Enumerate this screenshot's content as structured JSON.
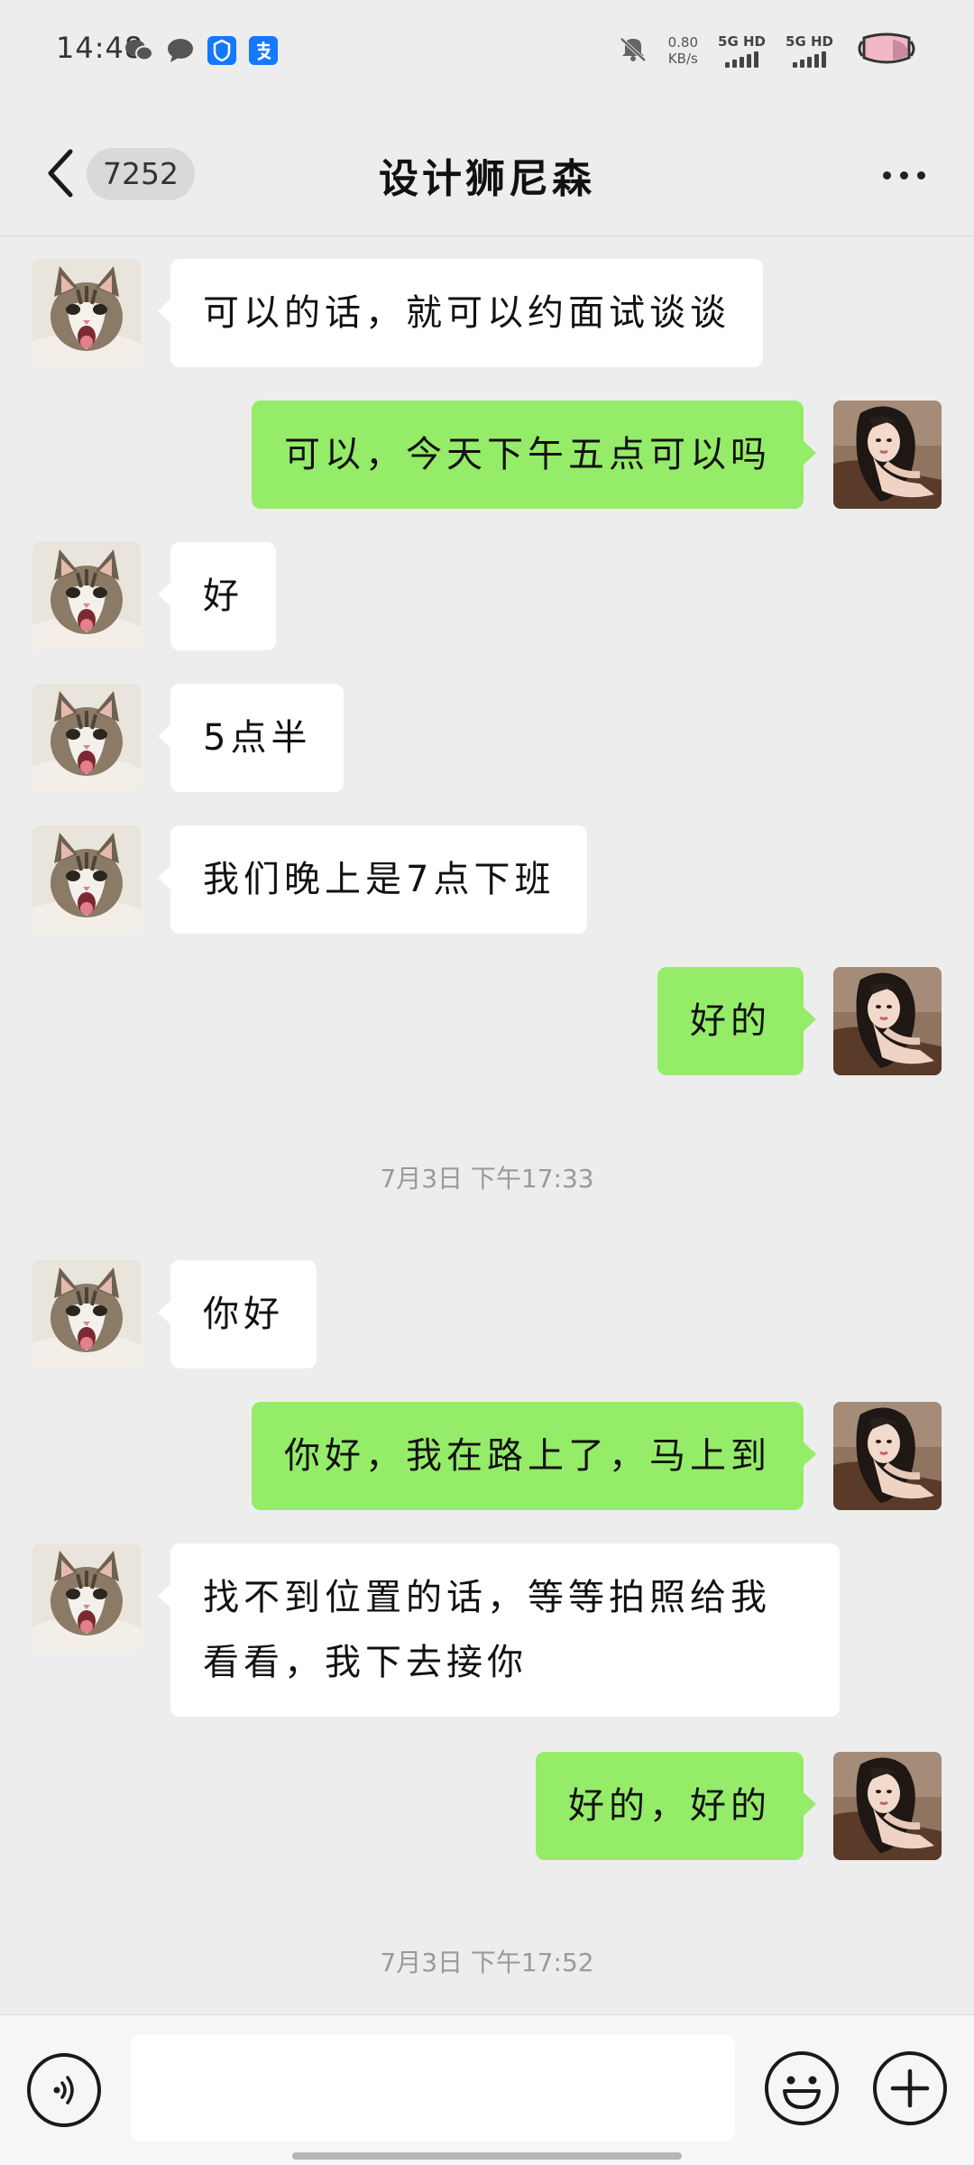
{
  "status_bar": {
    "time": "14:48",
    "app_icons": [
      "wechat-icon",
      "message-icon",
      "alipay-shield-icon",
      "alipay-icon"
    ],
    "net_speed_value": "0.80",
    "net_speed_unit": "KB/s",
    "sim1_label": "5G HD",
    "sim2_label": "5G HD",
    "mute_icon": "mute-icon",
    "battery_icon": "pink-battery-icon"
  },
  "header": {
    "unread_count": "7252",
    "title": "设计狮尼森"
  },
  "messages": [
    {
      "direction": "in",
      "text": "可以的话，就可以约面试谈谈"
    },
    {
      "direction": "out",
      "text": "可以，今天下午五点可以吗"
    },
    {
      "direction": "in",
      "text": "好"
    },
    {
      "direction": "in",
      "text": "5点半"
    },
    {
      "direction": "in",
      "text": "我们晚上是7点下班"
    },
    {
      "direction": "out",
      "text": "好的"
    },
    {
      "type": "timestamp",
      "text": "7月3日 下午17:33"
    },
    {
      "direction": "in",
      "text": "你好"
    },
    {
      "direction": "out",
      "text": "你好，我在路上了，马上到"
    },
    {
      "direction": "in",
      "text": "找不到位置的话，等等拍照给我看看，我下去接你"
    },
    {
      "direction": "out",
      "text": "好的，好的"
    },
    {
      "type": "timestamp",
      "text": "7月3日 下午17:52"
    }
  ],
  "input_bar": {
    "message_value": "",
    "voice_icon": "voice-icon",
    "emoji_icon": "emoji-icon",
    "plus_icon": "plus-icon"
  },
  "colors": {
    "background": "#ededed",
    "incoming_bubble": "#ffffff",
    "outgoing_bubble": "#95ec69",
    "timestamp_text": "#9a9a9a"
  }
}
